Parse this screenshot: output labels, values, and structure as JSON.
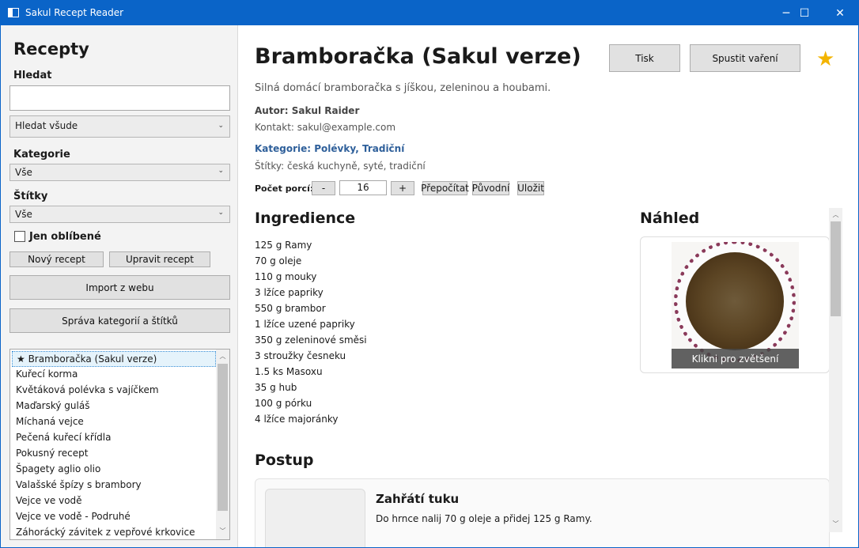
{
  "window": {
    "title": "Sakul Recept Reader",
    "minimize": "─",
    "maximize": "☐",
    "close": "✕"
  },
  "sidebar": {
    "heading": "Recepty",
    "search": {
      "label": "Hledat",
      "value": "",
      "scope": "Hledat všude"
    },
    "category": {
      "label": "Kategorie",
      "value": "Vše"
    },
    "tags": {
      "label": "Štítky",
      "value": "Vše"
    },
    "favorites_only": "Jen oblíbené",
    "buttons": {
      "new": "Nový recept",
      "edit": "Upravit recept",
      "import": "Import z webu",
      "manage": "Správa kategorií a štítků"
    },
    "recipes": [
      "★ Bramboračka (Sakul verze)",
      "Kuřecí korma",
      "Květáková polévka s vajíčkem",
      "Maďarský guláš",
      "Míchaná vejce",
      "Pečená kuřecí křídla",
      "Pokusný recept",
      "Špagety aglio olio",
      "Valašské špízy s brambory",
      "Vejce ve vodě",
      "Vejce ve vodě - Podruhé",
      "Záhorácký závitek z vepřové krkovice"
    ]
  },
  "recipe": {
    "title": "Bramboračka (Sakul verze)",
    "description": "Silná domácí bramboračka s jíškou, zeleninou a houbami.",
    "author": "Autor: Sakul Raider",
    "contact": "Kontakt: sakul@example.com",
    "categories": "Kategorie: Polévky, Tradiční",
    "tags": "Štítky: česká kuchyně, syté, tradiční",
    "print": "Tisk",
    "start_cooking": "Spustit vaření",
    "favorite_star": "★",
    "servings": {
      "label": "Počet porcí:",
      "minus": "-",
      "value": "16",
      "plus": "+",
      "recalc": "Přepočítat",
      "original": "Původní",
      "save": "Uložit"
    },
    "ingredients_heading": "Ingredience",
    "ingredients": [
      "125 g Ramy",
      "70 g oleje",
      "110 g mouky",
      "3 lžíce papriky",
      "550 g brambor",
      "1 lžíce uzené papriky",
      "350 g zeleninové směsi",
      "3 stroužky česneku",
      "1.5 ks Masoxu",
      "35 g hub",
      "100 g pórku",
      "4 lžíce majoránky"
    ],
    "preview_heading": "Náhled",
    "preview_caption": "Klikni pro zvětšení",
    "steps_heading": "Postup",
    "step": {
      "title": "Zahřátí tuku",
      "text": "Do hrnce nalij 70 g oleje a přidej 125 g Ramy."
    }
  }
}
